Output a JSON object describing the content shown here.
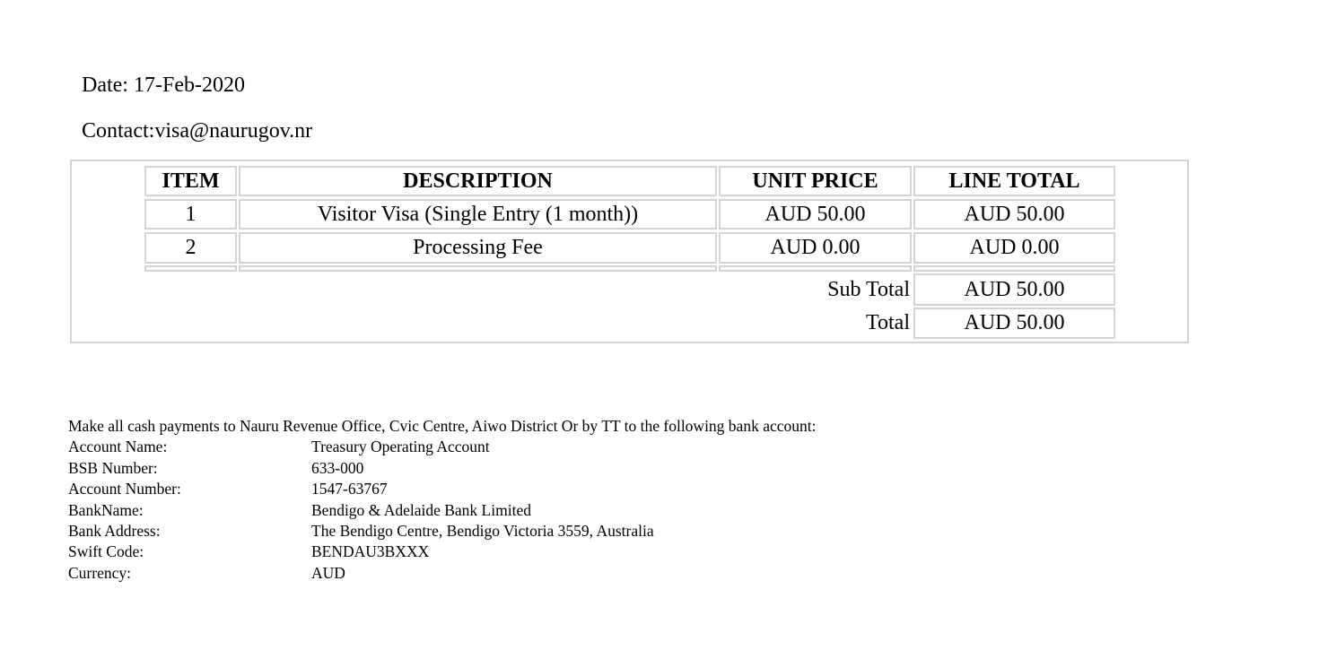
{
  "header": {
    "date_label": "Date: 17-Feb-2020",
    "contact_label": "Contact:visa@naurugov.nr"
  },
  "invoice": {
    "columns": [
      "ITEM",
      "DESCRIPTION",
      "UNIT PRICE",
      "LINE TOTAL"
    ],
    "rows": [
      {
        "item": "1",
        "description": "Visitor Visa (Single Entry (1 month))",
        "unit_price": "AUD 50.00",
        "line_total": "AUD 50.00"
      },
      {
        "item": "2",
        "description": "Processing Fee",
        "unit_price": "AUD 0.00",
        "line_total": "AUD 0.00"
      }
    ],
    "subtotal_label": "Sub Total",
    "subtotal_value": "AUD 50.00",
    "total_label": "Total",
    "total_value": "AUD 50.00"
  },
  "payment": {
    "intro": "Make all cash payments to Nauru Revenue Office, Cvic Centre, Aiwo District Or by TT to the following bank account:",
    "details": [
      {
        "label": "Account Name:",
        "value": "Treasury Operating Account"
      },
      {
        "label": "BSB Number:",
        "value": "633-000"
      },
      {
        "label": "Account Number:",
        "value": "1547-63767"
      },
      {
        "label": "BankName:",
        "value": "Bendigo & Adelaide Bank Limited"
      },
      {
        "label": "Bank Address:",
        "value": "The Bendigo Centre, Bendigo Victoria 3559, Australia"
      },
      {
        "label": "Swift Code:",
        "value": "BENDAU3BXXX"
      },
      {
        "label": "Currency:",
        "value": "AUD"
      }
    ]
  }
}
